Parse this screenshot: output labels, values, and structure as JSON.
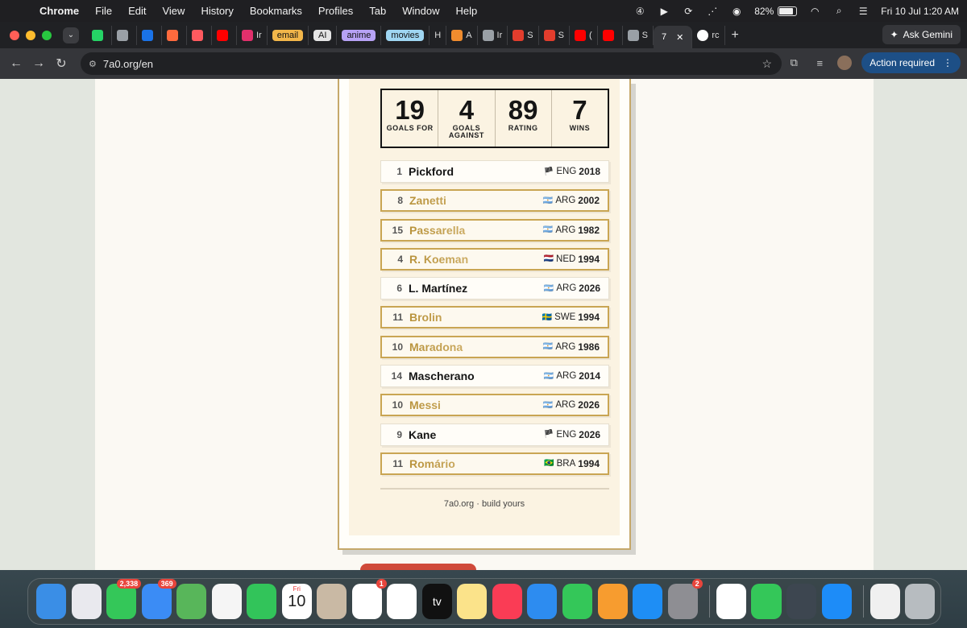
{
  "menubar": {
    "app": "Chrome",
    "items": [
      "File",
      "Edit",
      "View",
      "History",
      "Bookmarks",
      "Profiles",
      "Tab",
      "Window",
      "Help"
    ],
    "battery": "82%",
    "battery_level": 0.82,
    "datetime": "Fri 10 Jul  1:20 AM"
  },
  "tabs": [
    {
      "label": "",
      "color": "#25d366"
    },
    {
      "label": "",
      "color": "#9aa0a6"
    },
    {
      "label": "",
      "color": "#1a73e8"
    },
    {
      "label": "",
      "color": "#ff6a3d"
    },
    {
      "label": "",
      "color": "#ff5a5f"
    },
    {
      "label": "",
      "color": "#ff0000"
    },
    {
      "label": "Ir",
      "color": "#e1306c"
    },
    {
      "label": "email",
      "chip": "#f2b64a"
    },
    {
      "label": "AI",
      "chip": "#e5e5e5"
    },
    {
      "label": "anime",
      "chip": "#b7a2f5"
    },
    {
      "label": "movies",
      "chip": "#9fd6f2"
    },
    {
      "label": "H",
      "color": ""
    },
    {
      "label": "A",
      "color": "#f08c2e"
    },
    {
      "label": "Ir",
      "color": "#9aa0a6"
    },
    {
      "label": "S",
      "color": "#e23d2d"
    },
    {
      "label": "S",
      "color": "#e23d2d"
    },
    {
      "label": "(",
      "color": "#ff0000"
    },
    {
      "label": "",
      "color": "#ff0000"
    },
    {
      "label": "S",
      "color": "#9aa0a6"
    }
  ],
  "active_tab": {
    "label": "7"
  },
  "last_tab": {
    "label": "rc"
  },
  "gemini": {
    "label": "Ask Gemini"
  },
  "toolbar": {
    "url": "7a0.org/en",
    "action_required": "Action required"
  },
  "card": {
    "stats": [
      {
        "value": "19",
        "label": "GOALS FOR"
      },
      {
        "value": "4",
        "label": "GOALS AGAINST"
      },
      {
        "value": "89",
        "label": "RATING"
      },
      {
        "value": "7",
        "label": "WINS"
      }
    ],
    "players": [
      {
        "num": "1",
        "name": "Pickford",
        "flag": "🏴",
        "country": "ENG",
        "year": "2018",
        "gold": false
      },
      {
        "num": "8",
        "name": "Zanetti",
        "flag": "🇦🇷",
        "country": "ARG",
        "year": "2002",
        "gold": true
      },
      {
        "num": "15",
        "name": "Passarella",
        "flag": "🇦🇷",
        "country": "ARG",
        "year": "1982",
        "gold": true
      },
      {
        "num": "4",
        "name": "R. Koeman",
        "flag": "🇳🇱",
        "country": "NED",
        "year": "1994",
        "gold": true
      },
      {
        "num": "6",
        "name": "L. Martínez",
        "flag": "🇦🇷",
        "country": "ARG",
        "year": "2026",
        "gold": false
      },
      {
        "num": "11",
        "name": "Brolin",
        "flag": "🇸🇪",
        "country": "SWE",
        "year": "1994",
        "gold": true
      },
      {
        "num": "10",
        "name": "Maradona",
        "flag": "🇦🇷",
        "country": "ARG",
        "year": "1986",
        "gold": true
      },
      {
        "num": "14",
        "name": "Mascherano",
        "flag": "🇦🇷",
        "country": "ARG",
        "year": "2014",
        "gold": false
      },
      {
        "num": "10",
        "name": "Messi",
        "flag": "🇦🇷",
        "country": "ARG",
        "year": "2026",
        "gold": true
      },
      {
        "num": "9",
        "name": "Kane",
        "flag": "🏴",
        "country": "ENG",
        "year": "2026",
        "gold": false
      },
      {
        "num": "11",
        "name": "Romário",
        "flag": "🇧🇷",
        "country": "BRA",
        "year": "1994",
        "gold": true
      }
    ],
    "footer": "7a0.org · build yours"
  },
  "dock": [
    {
      "name": "finder",
      "color": "#3a8ee6"
    },
    {
      "name": "launchpad",
      "color": "#e9e9ee"
    },
    {
      "name": "messages",
      "color": "#34c759",
      "badge": "2,338"
    },
    {
      "name": "mail",
      "color": "#3b8cf5",
      "badge": "369"
    },
    {
      "name": "maps",
      "color": "#58b65a"
    },
    {
      "name": "photos",
      "color": "#f5f5f5"
    },
    {
      "name": "facetime",
      "color": "#32c45a"
    },
    {
      "name": "calendar",
      "color": "#ffffff",
      "text": "10",
      "sub": "Fri"
    },
    {
      "name": "contacts",
      "color": "#c9b9a4"
    },
    {
      "name": "reminders",
      "color": "#ffffff",
      "badge": "1"
    },
    {
      "name": "freeform",
      "color": "#ffffff"
    },
    {
      "name": "tv",
      "color": "#111111",
      "text": "tv"
    },
    {
      "name": "notes",
      "color": "#fbe38a"
    },
    {
      "name": "music",
      "color": "#fa3c55"
    },
    {
      "name": "keynote",
      "color": "#2d8cf0"
    },
    {
      "name": "numbers",
      "color": "#34c759"
    },
    {
      "name": "pages",
      "color": "#f79c2f"
    },
    {
      "name": "app-store",
      "color": "#1e8ef5"
    },
    {
      "name": "system-settings",
      "color": "#8e8e93",
      "badge": "2"
    },
    {
      "name": "chrome",
      "color": "#ffffff"
    },
    {
      "name": "phone",
      "color": "#34c759"
    },
    {
      "name": "iphone-mirroring",
      "color": "#3d4650"
    },
    {
      "name": "safari",
      "color": "#1d8cf8"
    },
    {
      "name": "document",
      "color": "#f0f0f0"
    },
    {
      "name": "trash",
      "color": "#b7bcc0"
    }
  ]
}
